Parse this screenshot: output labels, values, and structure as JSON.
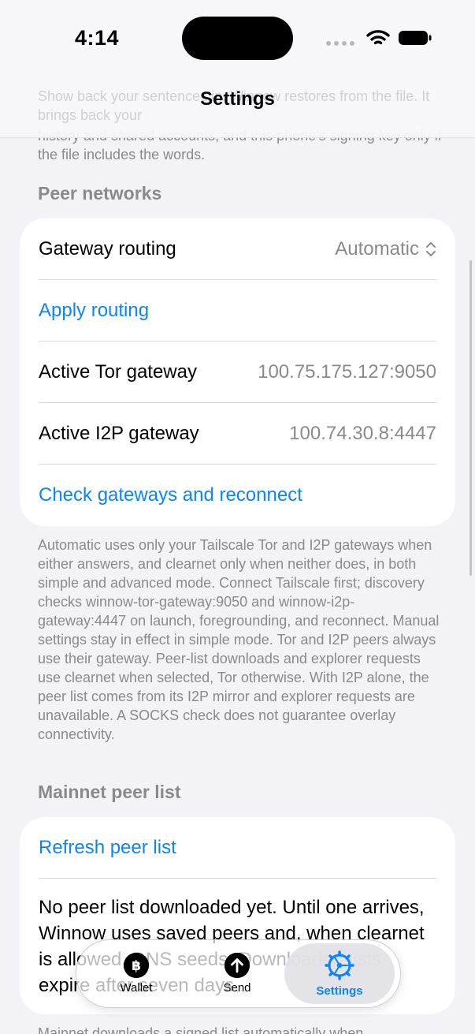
{
  "status_bar": {
    "time": "4:14"
  },
  "nav": {
    "title": "Settings"
  },
  "ghost_header_text": "Show back your sentences in. Winnow restores from the file. It brings back your",
  "previous_note": "history and shared accounts, and this phone's signing key only if the file includes the words.",
  "peer_networks": {
    "header": "Peer networks",
    "gateway_routing_label": "Gateway routing",
    "gateway_routing_value": "Automatic",
    "apply_routing": "Apply routing",
    "tor_label": "Active Tor gateway",
    "tor_value": "100.75.175.127:9050",
    "i2p_label": "Active I2P gateway",
    "i2p_value": "100.74.30.8:4447",
    "check_gateways": "Check gateways and reconnect",
    "footnote": "Automatic uses only your Tailscale Tor and I2P gateways when either answers, and clearnet only when neither does, in both simple and advanced mode. Connect Tailscale first; discovery checks winnow-tor-gateway:9050 and winnow-i2p-gateway:4447 on launch, foregrounding, and reconnect. Manual settings stay in effect in simple mode. Tor and I2P peers always use their gateway. Peer-list downloads and explorer requests use clearnet when selected, Tor otherwise. With I2P alone, the peer list comes from its I2P mirror and explorer requests are unavailable. A SOCKS check does not guarantee overlay connectivity."
  },
  "mainnet_peer_list": {
    "header": "Mainnet peer list",
    "refresh": "Refresh peer list",
    "status_text": "No peer list downloaded yet. Until one arrives, Winnow uses saved peers and, when clearnet is allowed, DNS seeds. Downloaded lists expire after seven days.",
    "footnote": "Mainnet downloads a signed list automatically when"
  },
  "tab_bar": {
    "wallet": "Wallet",
    "send": "Send",
    "settings": "Settings",
    "active": "settings"
  },
  "colors": {
    "accent": "#0a84ff",
    "background": "#f2f2f7",
    "secondary_text": "#8a8a8e"
  }
}
